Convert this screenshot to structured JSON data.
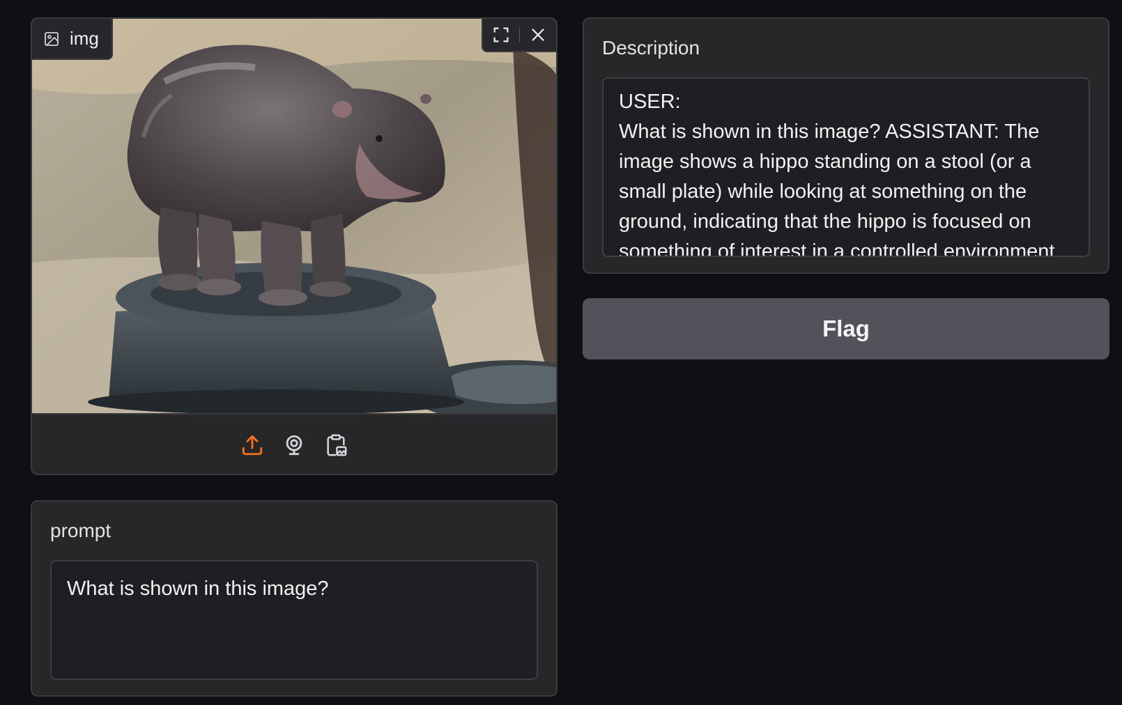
{
  "image_input": {
    "label": "img",
    "label_icon": "image-icon",
    "controls": [
      "fullscreen-icon",
      "close-icon"
    ],
    "sources": [
      "upload-icon",
      "webcam-icon",
      "clipboard-icon"
    ],
    "active_source_color": "#f97316"
  },
  "prompt": {
    "label": "prompt",
    "value": "What is shown in this image?"
  },
  "description": {
    "label": "Description",
    "value": "USER:\nWhat is shown in this image? ASSISTANT: The image shows a hippo standing on a stool (or a small plate) while looking at something on the ground, indicating that the hippo is focused on something of interest in a controlled environment."
  },
  "flag": {
    "label": "Flag"
  }
}
